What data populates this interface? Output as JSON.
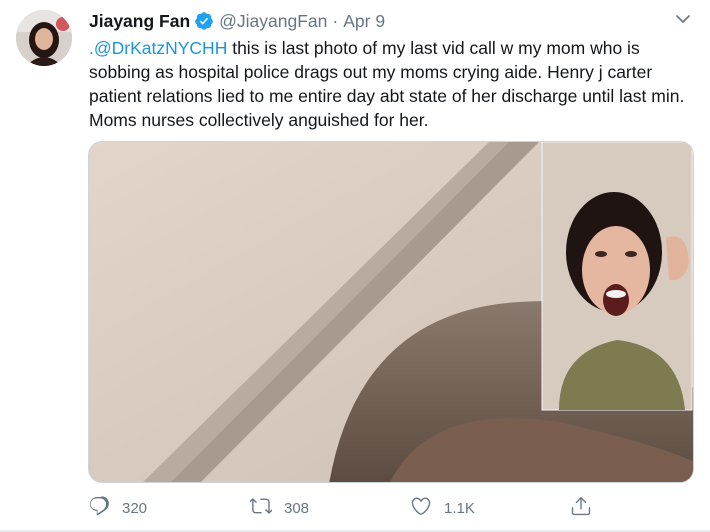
{
  "tweet": {
    "author_name": "Jiayang Fan",
    "handle": "@JiayangFan",
    "separator": "·",
    "date": "Apr 9",
    "text_mention": ".@DrKatzNYCHH",
    "text_body": " this is last photo of my last vid call w my mom who is sobbing as hospital police drags out my moms crying aide. Henry j carter patient relations lied to me entire day abt state of her discharge until last min. Moms nurses collectively anguished for her."
  },
  "actions": {
    "reply_count": "320",
    "retweet_count": "308",
    "like_count": "1.1K"
  },
  "colors": {
    "link": "#1b95e0",
    "secondary": "#657786",
    "verified": "#1da1f2",
    "primary_text": "#14171a"
  },
  "icons": {
    "verified": "verified-badge-icon",
    "more": "chevron-down-icon",
    "reply": "reply-icon",
    "retweet": "retweet-icon",
    "like": "heart-icon",
    "share": "share-icon"
  }
}
